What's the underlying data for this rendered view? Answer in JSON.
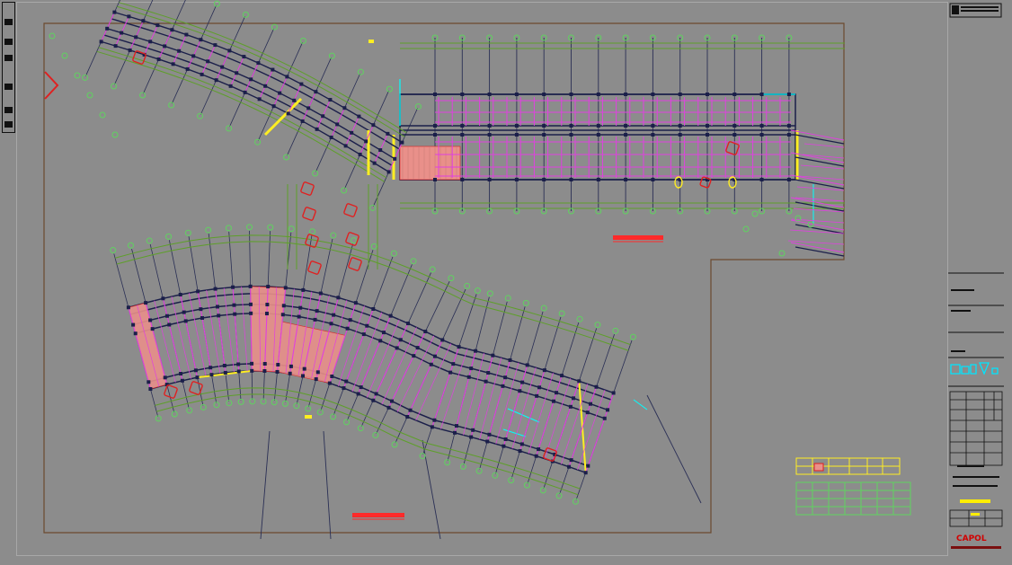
{
  "drawing": {
    "background": "#8c8c8c",
    "frame_color": "#6b4a2e",
    "colors": {
      "axis_green": "#5fd35f",
      "wall_green": "#5e9f2a",
      "beam_magenta": "#e040e0",
      "column_navy": "#1b1f4a",
      "grid_line": "#2a2f55",
      "hatch_salmon": "#e9908a",
      "highlight_red": "#e02020",
      "yellow": "#ffee22",
      "cyan": "#00ffff"
    },
    "plans": [
      {
        "id": "upper-plan",
        "title_color": "#ff2a2a"
      },
      {
        "id": "lower-plan",
        "title_color": "#ff2a2a"
      }
    ]
  },
  "legend": {
    "yellow_table_rows": 2,
    "yellow_table_cols": 6,
    "green_table_rows": 4,
    "green_table_cols": 7
  },
  "title_block": {
    "logo": "CAPOL",
    "accent_cyan": "#00e5ff",
    "accent_yellow": "#ffee00"
  }
}
